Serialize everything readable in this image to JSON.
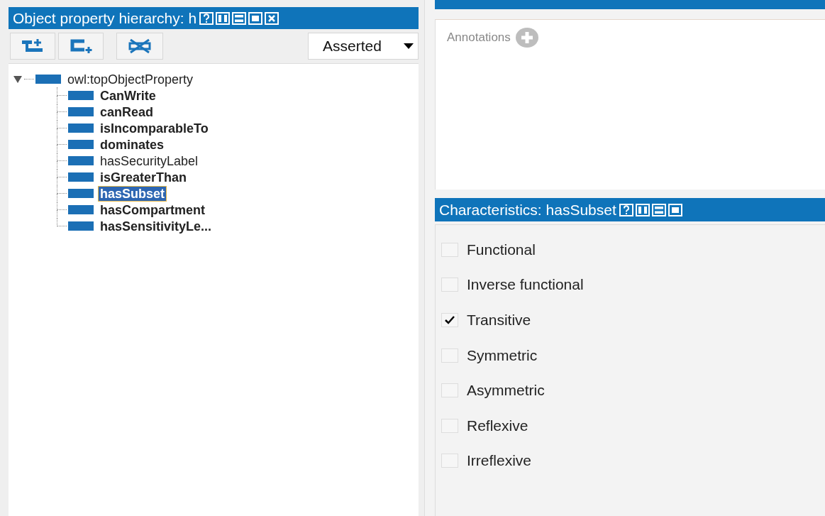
{
  "hierarchy_panel": {
    "title": "Object property hierarchy: h",
    "toolbar": {
      "view_select": {
        "value": "Asserted"
      }
    },
    "tree": [
      {
        "label": "owl:topObjectProperty",
        "bold": false,
        "selected": false,
        "expanded": true,
        "children": [
          {
            "label": "CanWrite",
            "bold": true,
            "selected": false
          },
          {
            "label": "canRead",
            "bold": true,
            "selected": false
          },
          {
            "label": "isIncomparableTo",
            "bold": true,
            "selected": false
          },
          {
            "label": "dominates",
            "bold": true,
            "selected": false
          },
          {
            "label": "hasSecurityLabel",
            "bold": false,
            "selected": false
          },
          {
            "label": "isGreaterThan",
            "bold": true,
            "selected": false
          },
          {
            "label": "hasSubset",
            "bold": true,
            "selected": true
          },
          {
            "label": "hasCompartment",
            "bold": true,
            "selected": false
          },
          {
            "label": "hasSensitivityLe...",
            "bold": true,
            "selected": false
          }
        ]
      }
    ]
  },
  "annotations_panel": {
    "label": "Annotations"
  },
  "characteristics_panel": {
    "title": "Characteristics: hasSubset",
    "options": [
      {
        "label": "Functional",
        "checked": false
      },
      {
        "label": "Inverse functional",
        "checked": false
      },
      {
        "label": "Transitive",
        "checked": true
      },
      {
        "label": "Symmetric",
        "checked": false
      },
      {
        "label": "Asymmetric",
        "checked": false
      },
      {
        "label": "Reflexive",
        "checked": false
      },
      {
        "label": "Irreflexive",
        "checked": false
      }
    ]
  }
}
